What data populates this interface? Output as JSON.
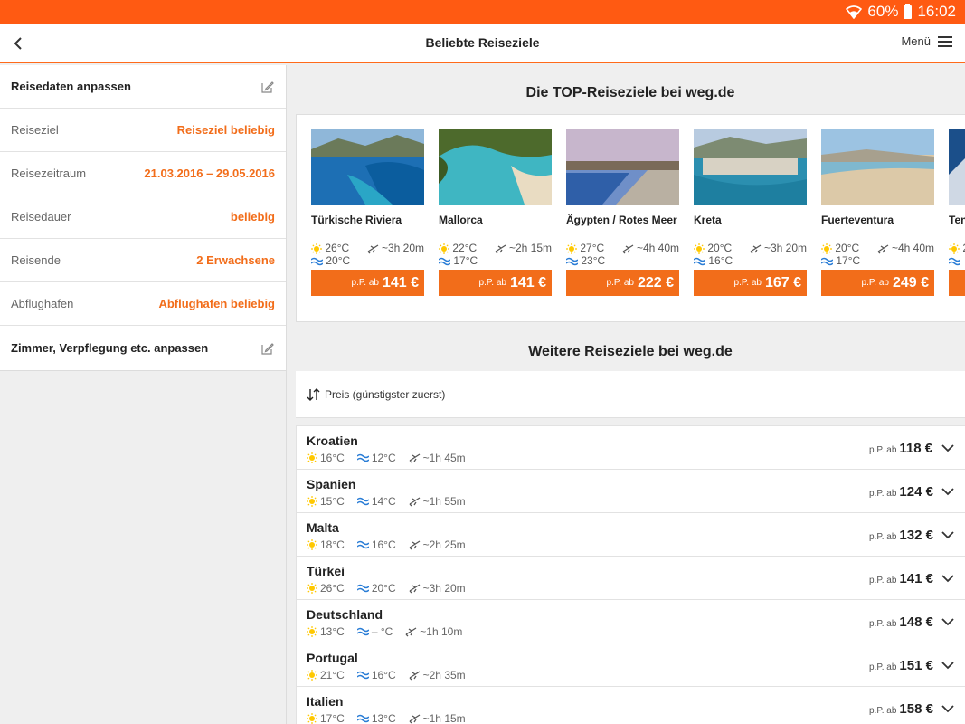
{
  "status": {
    "battery": "60%",
    "time": "16:02"
  },
  "appbar": {
    "title": "Beliebte Reiseziele",
    "menu_label": "Menü"
  },
  "sidebar": {
    "header": "Reisedaten anpassen",
    "rows": [
      {
        "label": "Reiseziel",
        "value": "Reiseziel beliebig"
      },
      {
        "label": "Reisezeitraum",
        "value": "21.03.2016 – 29.05.2016"
      },
      {
        "label": "Reisedauer",
        "value": "beliebig"
      },
      {
        "label": "Reisende",
        "value": "2 Erwachsene"
      },
      {
        "label": "Abflughafen",
        "value": "Abflughafen beliebig"
      }
    ],
    "footer": "Zimmer, Verpflegung etc. anpassen"
  },
  "top": {
    "title": "Die TOP-Reiseziele bei weg.de",
    "cards": [
      {
        "name": "Türkische Riviera",
        "air": "26°C",
        "flight": "~3h 20m",
        "water": "20°C",
        "pp": "p.P. ab",
        "price": "141 €"
      },
      {
        "name": "Mallorca",
        "air": "22°C",
        "flight": "~2h 15m",
        "water": "17°C",
        "pp": "p.P. ab",
        "price": "141 €"
      },
      {
        "name": "Ägypten / Rotes Meer",
        "air": "27°C",
        "flight": "~4h 40m",
        "water": "23°C",
        "pp": "p.P. ab",
        "price": "222 €"
      },
      {
        "name": "Kreta",
        "air": "20°C",
        "flight": "~3h 20m",
        "water": "16°C",
        "pp": "p.P. ab",
        "price": "167 €"
      },
      {
        "name": "Fuerteventura",
        "air": "20°C",
        "flight": "~4h 40m",
        "water": "17°C",
        "pp": "p.P. ab",
        "price": "249 €"
      },
      {
        "name": "Ten",
        "air": "2",
        "flight": "",
        "water": "",
        "pp": "",
        "price": ""
      }
    ]
  },
  "more": {
    "title": "Weitere Reiseziele bei weg.de",
    "sort_label": "Preis (günstigster zuerst)",
    "rows": [
      {
        "name": "Kroatien",
        "air": "16°C",
        "water": "12°C",
        "flight": "~1h 45m",
        "pp": "p.P. ab",
        "price": "118 €"
      },
      {
        "name": "Spanien",
        "air": "15°C",
        "water": "14°C",
        "flight": "~1h 55m",
        "pp": "p.P. ab",
        "price": "124 €"
      },
      {
        "name": "Malta",
        "air": "18°C",
        "water": "16°C",
        "flight": "~2h 25m",
        "pp": "p.P. ab",
        "price": "132 €"
      },
      {
        "name": "Türkei",
        "air": "26°C",
        "water": "20°C",
        "flight": "~3h 20m",
        "pp": "p.P. ab",
        "price": "141 €"
      },
      {
        "name": "Deutschland",
        "air": "13°C",
        "water": "– °C",
        "flight": "~1h 10m",
        "pp": "p.P. ab",
        "price": "148 €"
      },
      {
        "name": "Portugal",
        "air": "21°C",
        "water": "16°C",
        "flight": "~2h 35m",
        "pp": "p.P. ab",
        "price": "151 €"
      },
      {
        "name": "Italien",
        "air": "17°C",
        "water": "13°C",
        "flight": "~1h 15m",
        "pp": "p.P. ab",
        "price": "158 €"
      }
    ]
  },
  "colors": {
    "brand": "#ff5a12",
    "accent": "#f26d1a"
  }
}
